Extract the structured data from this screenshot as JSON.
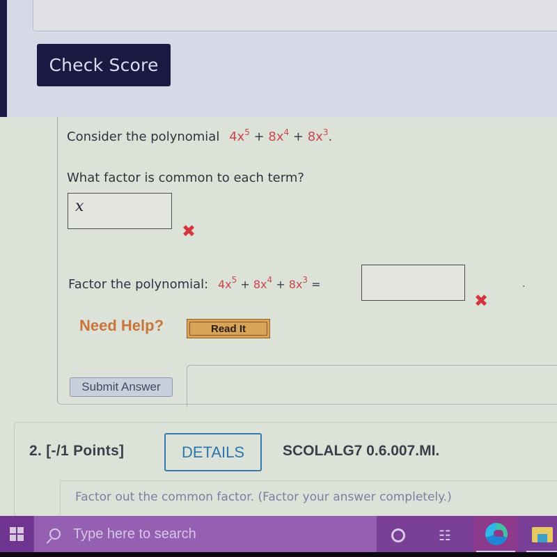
{
  "top": {
    "check_score_label": "Check Score"
  },
  "question1": {
    "intro": "Consider the polynomial",
    "polynomial_terms": [
      {
        "coef": "4x",
        "exp": "5"
      },
      {
        "coef": "8x",
        "exp": "4"
      },
      {
        "coef": "8x",
        "exp": "3"
      }
    ],
    "plus": "+",
    "period": ".",
    "equals": "=",
    "part1_prompt": "What factor is common to each term?",
    "part1_answer": "x",
    "part1_status": "incorrect",
    "part2_prompt": "Factor the polynomial:",
    "part2_answer": "",
    "part2_status": "incorrect",
    "wrong_mark": "✖",
    "need_help_label": "Need Help?",
    "read_it_label": "Read It",
    "submit_label": "Submit Answer"
  },
  "question2": {
    "number_points": "2.  [-/1 Points]",
    "details_label": "DETAILS",
    "code": "SCOLALG7 0.6.007.MI.",
    "instruction": "Factor out the common factor. (Factor your answer completely.)"
  },
  "taskbar": {
    "search_placeholder": "Type here to search",
    "icons": [
      "windows-start-icon",
      "search-icon",
      "cortana-icon",
      "task-view-icon",
      "edge-icon",
      "file-explorer-icon"
    ]
  },
  "colors": {
    "check_score_bg": "#1b1942",
    "polynomial_red": "#c9454d",
    "wrong_red": "#d4353f",
    "need_help_orange": "#c8743a",
    "details_blue": "#2a76ad",
    "taskbar_purple": "#7a3f97"
  }
}
